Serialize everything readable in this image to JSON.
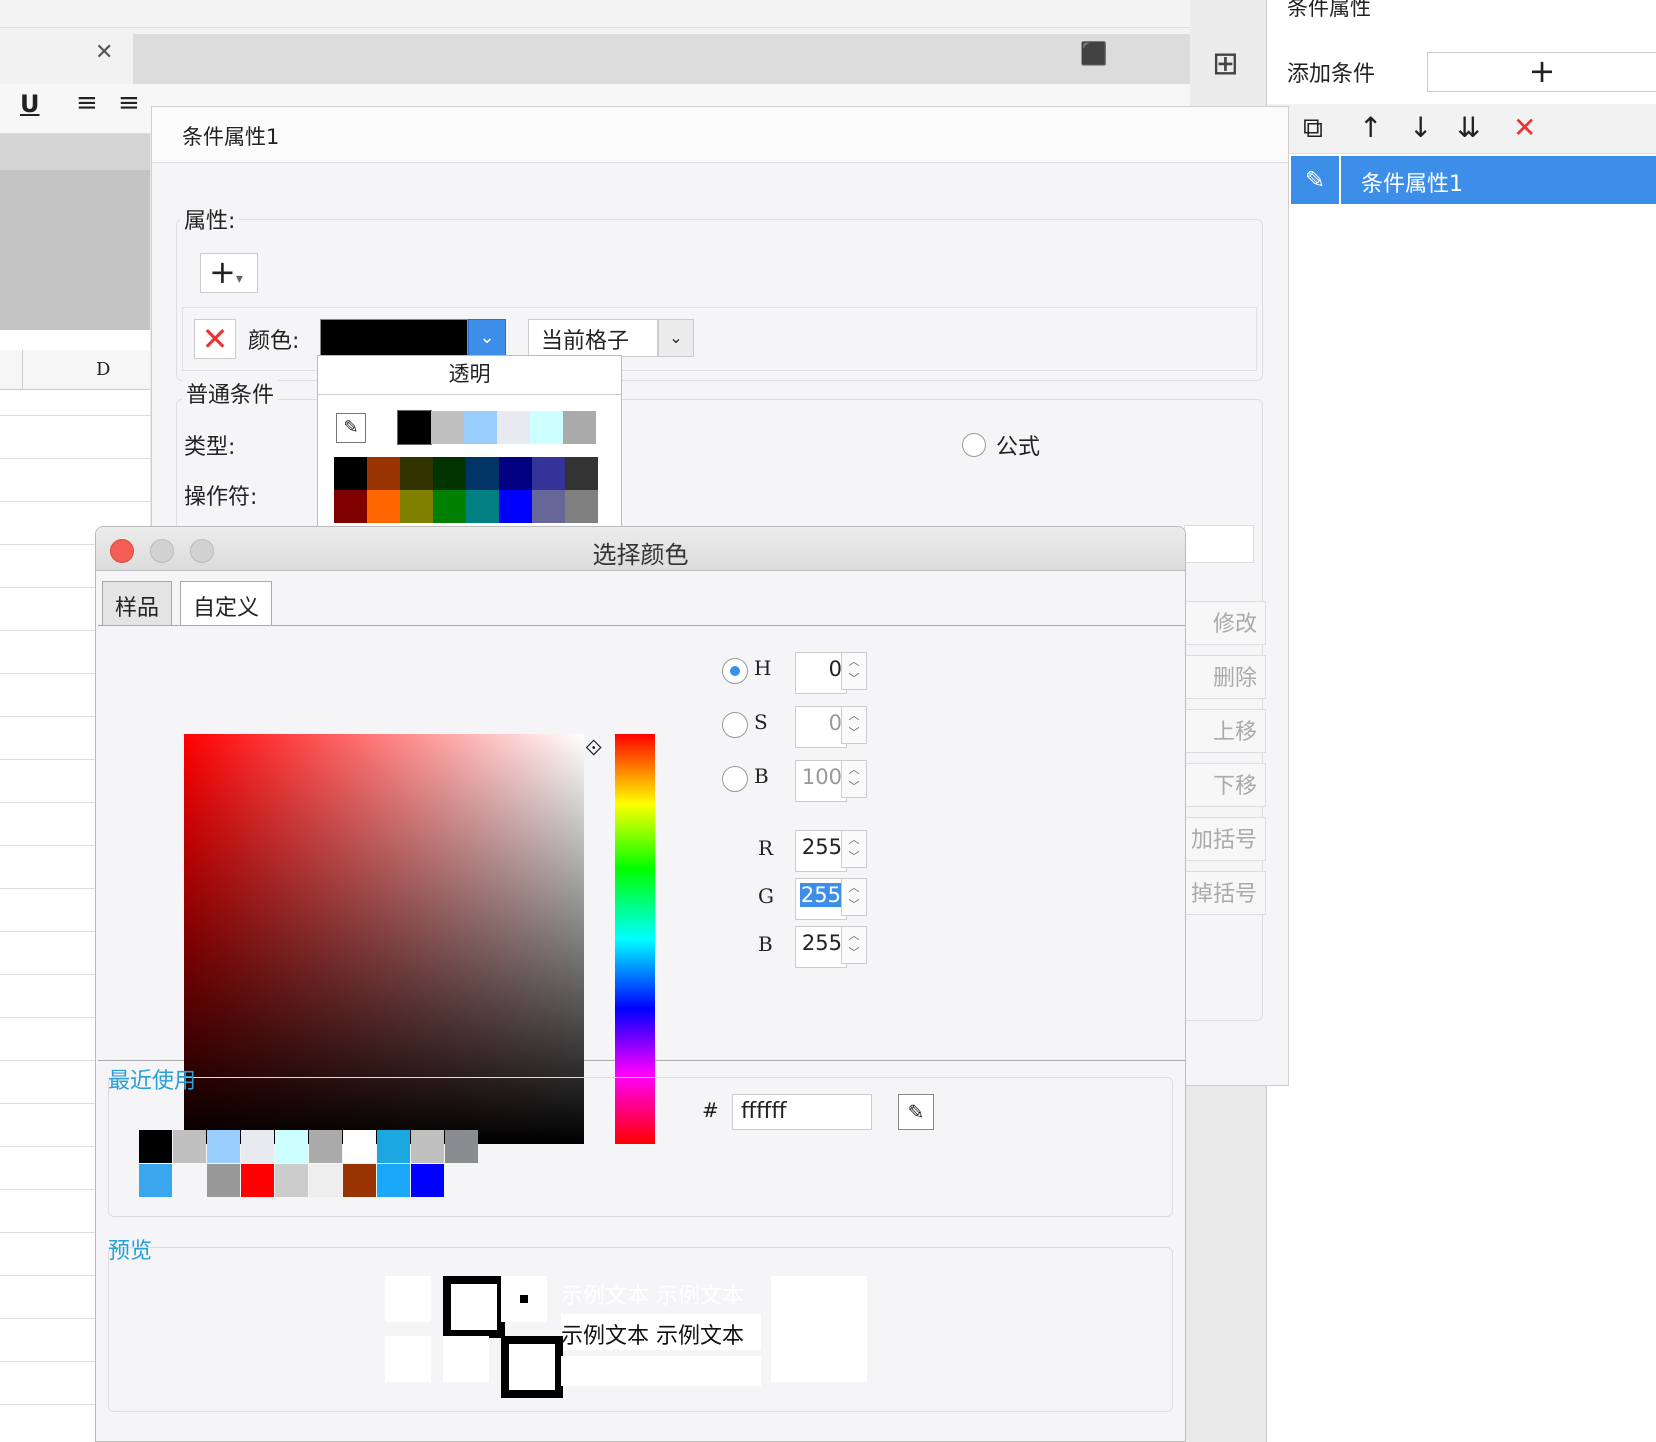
{
  "background": {
    "column_header": "D"
  },
  "right_panel": {
    "title": "条件属性",
    "add_condition_label": "添加条件",
    "add_button": "+",
    "toolbar_delete": "✕",
    "selected_item": "条件属性1"
  },
  "condition_dialog": {
    "title": "条件属性1",
    "property_label": "属性:",
    "add_property": "+",
    "delete_property": "✕",
    "color_label": "颜色:",
    "color_value": "#000000",
    "scope_value": "当前格子",
    "common_conditions_label": "普通条件",
    "type_label": "类型:",
    "operator_label": "操作符:",
    "formula_label": "公式",
    "side_buttons": [
      "修改",
      "删除",
      "上移",
      "下移",
      "加括号",
      "掉括号"
    ]
  },
  "palette": {
    "transparent_label": "透明",
    "row1": [
      "#000000",
      "#c0c0c0",
      "#99ccff",
      "#e8eaf0",
      "#ccffff",
      "#aaaaaa"
    ],
    "grid": [
      [
        "#000000",
        "#993300",
        "#333300",
        "#003300",
        "#003366",
        "#000080",
        "#333399",
        "#333333"
      ],
      [
        "#800000",
        "#ff6600",
        "#808000",
        "#008000",
        "#008080",
        "#0000ff",
        "#666699",
        "#808080"
      ]
    ]
  },
  "color_dialog": {
    "title": "选择颜色",
    "tabs": [
      "样品",
      "自定义"
    ],
    "hsb": {
      "h_label": "H",
      "s_label": "S",
      "b_label": "B",
      "h": "0",
      "s": "0",
      "b": "100",
      "selected": "H"
    },
    "rgb": {
      "r_label": "R",
      "g_label": "G",
      "b_label": "B",
      "r": "255",
      "g": "255",
      "b": "255"
    },
    "hash_label": "#",
    "hex_value": "ffffff",
    "recent_label": "最近使用",
    "recent_colors": [
      [
        "#000000",
        "#c0c0c0",
        "#99ccff",
        "#e8eaf0",
        "#ccffff",
        "#aaaaaa",
        "#ffffff",
        "#1ba8e0",
        "#c0c0c0",
        "#8a8c90"
      ],
      [
        "#3aa6ee",
        "#f5f5f7",
        "#999999",
        "#ff0000",
        "#cccccc",
        "#eeeeee",
        "#993300",
        "#1ba8f8",
        "#0000ff",
        "#f5f5f7"
      ]
    ],
    "preview_label": "预览",
    "preview_sample_text": "示例文本  示例文本"
  }
}
